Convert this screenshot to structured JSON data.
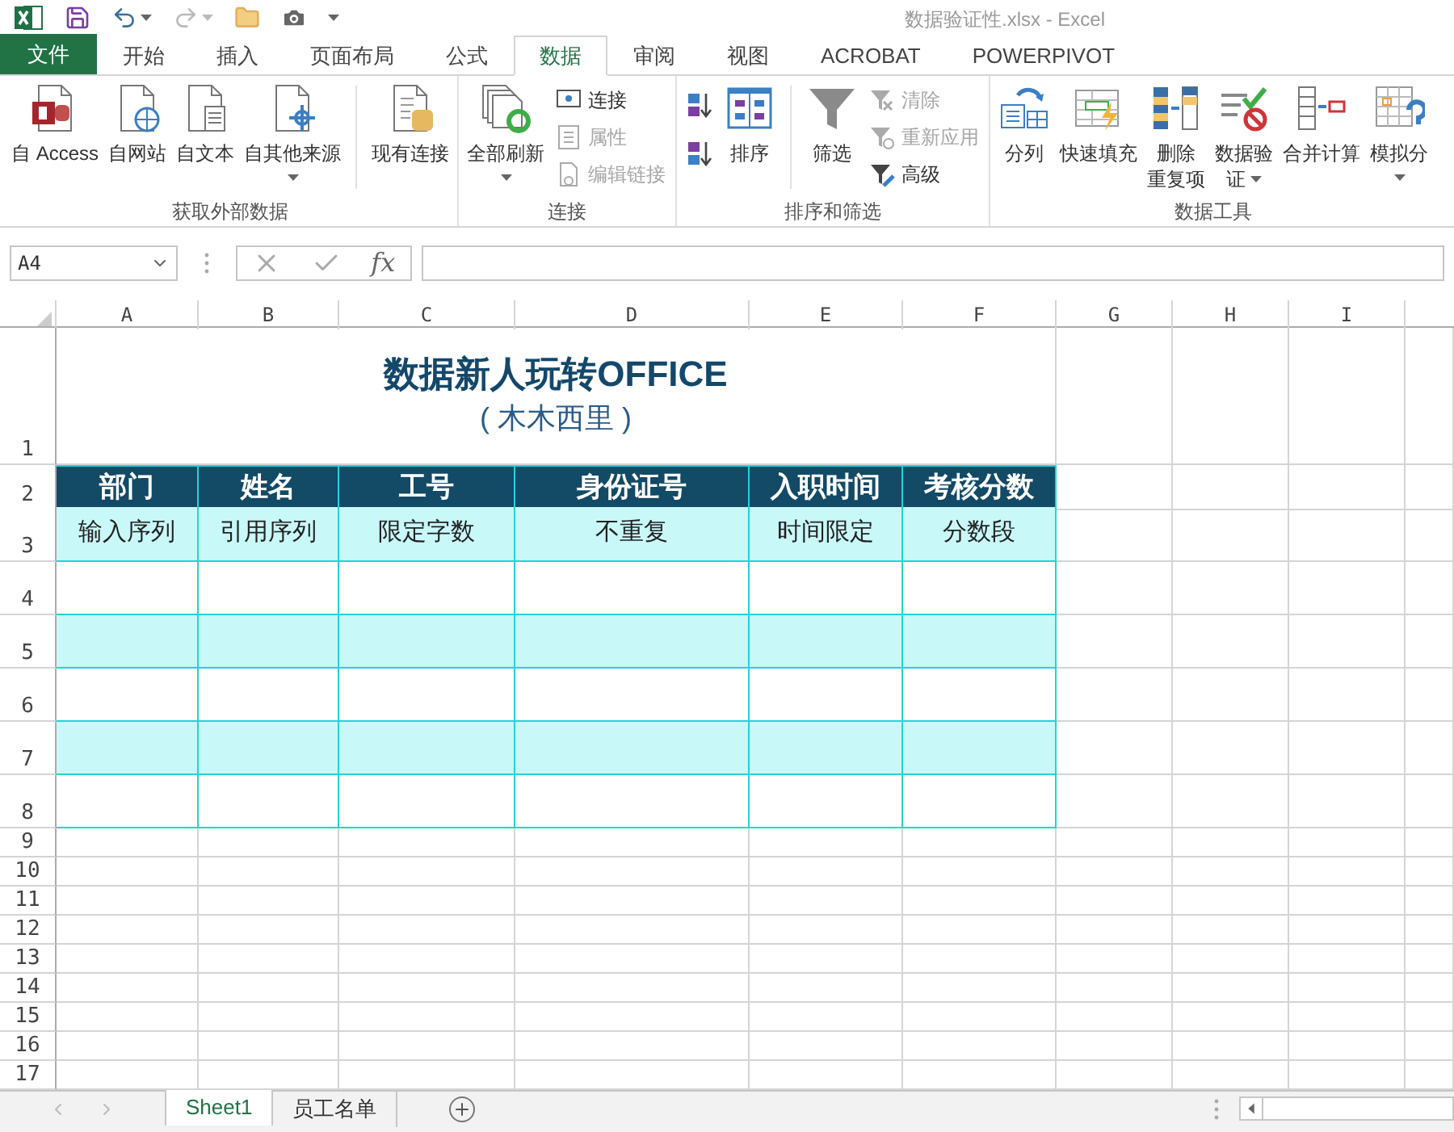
{
  "window": {
    "title": "数据验证性.xlsx - Excel"
  },
  "ribbon_tabs": [
    {
      "label": "文件",
      "kind": "file",
      "selected": false
    },
    {
      "label": "开始",
      "kind": "tab",
      "selected": false
    },
    {
      "label": "插入",
      "kind": "tab",
      "selected": false
    },
    {
      "label": "页面布局",
      "kind": "tab",
      "selected": false
    },
    {
      "label": "公式",
      "kind": "tab",
      "selected": false
    },
    {
      "label": "数据",
      "kind": "tab",
      "selected": true
    },
    {
      "label": "审阅",
      "kind": "tab",
      "selected": false
    },
    {
      "label": "视图",
      "kind": "tab",
      "selected": false
    },
    {
      "label": "ACROBAT",
      "kind": "tab",
      "selected": false
    },
    {
      "label": "POWERPIVOT",
      "kind": "tab",
      "selected": false
    }
  ],
  "ribbon": {
    "groups": [
      {
        "label": "获取外部数据",
        "items": [
          {
            "kind": "large",
            "lines": [
              "自 Access"
            ],
            "has_menu": false
          },
          {
            "kind": "large",
            "lines": [
              "自网站"
            ],
            "has_menu": false
          },
          {
            "kind": "large",
            "lines": [
              "自文本"
            ],
            "has_menu": false
          },
          {
            "kind": "large",
            "lines": [
              "自其他来源"
            ],
            "has_menu": true
          },
          {
            "kind": "separator"
          },
          {
            "kind": "large",
            "lines": [
              "现有连接"
            ],
            "has_menu": false
          }
        ]
      },
      {
        "label": "连接",
        "items": [
          {
            "kind": "large",
            "lines": [
              "全部刷新"
            ],
            "has_menu": true
          },
          {
            "kind": "stack",
            "buttons": [
              {
                "label": "连接",
                "disabled": false
              },
              {
                "label": "属性",
                "disabled": true
              },
              {
                "label": "编辑链接",
                "disabled": true
              }
            ]
          }
        ]
      },
      {
        "label": "排序和筛选",
        "items": [
          {
            "kind": "sort_buttons"
          },
          {
            "kind": "large",
            "lines": [
              "排序"
            ],
            "has_menu": false
          },
          {
            "kind": "separator"
          },
          {
            "kind": "large",
            "lines": [
              "筛选"
            ],
            "has_menu": false
          },
          {
            "kind": "stack",
            "buttons": [
              {
                "label": "清除",
                "disabled": true
              },
              {
                "label": "重新应用",
                "disabled": true
              },
              {
                "label": "高级",
                "disabled": false
              }
            ]
          }
        ]
      },
      {
        "label": "数据工具",
        "items": [
          {
            "kind": "large",
            "lines": [
              "分列"
            ],
            "has_menu": false
          },
          {
            "kind": "large",
            "lines": [
              "快速填充"
            ],
            "has_menu": false
          },
          {
            "kind": "large",
            "lines": [
              "删除",
              "重复项"
            ],
            "has_menu": false
          },
          {
            "kind": "large",
            "lines": [
              "数据验",
              "证"
            ],
            "has_menu": true
          },
          {
            "kind": "large",
            "lines": [
              "合并计算"
            ],
            "has_menu": false
          },
          {
            "kind": "large",
            "lines": [
              "模拟分"
            ],
            "has_menu": true
          }
        ]
      }
    ]
  },
  "formula_bar": {
    "name_box": "A4",
    "function_label": "fx"
  },
  "sheet": {
    "column_headers": [
      "A",
      "B",
      "C",
      "D",
      "E",
      "F",
      "G",
      "H",
      "I"
    ],
    "row_headers": [
      "1",
      "2",
      "3",
      "4",
      "5",
      "6",
      "7",
      "8",
      "9",
      "10",
      "11",
      "12",
      "13",
      "14",
      "15",
      "16",
      "17"
    ],
    "title": "数据新人玩转OFFICE",
    "subtitle": "( 木木西里 )",
    "table": {
      "columns": [
        "部门",
        "姓名",
        "工号",
        "身份证号",
        "入职时间",
        "考核分数"
      ],
      "rows": [
        {
          "cells": [
            "输入序列",
            "引用序列",
            "限定字数",
            "不重复",
            "时间限定",
            "分数段"
          ],
          "shaded": true
        },
        {
          "shaded": false
        },
        {
          "shaded": true
        },
        {
          "shaded": false
        },
        {
          "shaded": true
        },
        {
          "shaded": false
        }
      ]
    }
  },
  "sheet_tabs": [
    {
      "label": "Sheet1",
      "selected": true
    },
    {
      "label": "员工名单",
      "selected": false
    }
  ]
}
